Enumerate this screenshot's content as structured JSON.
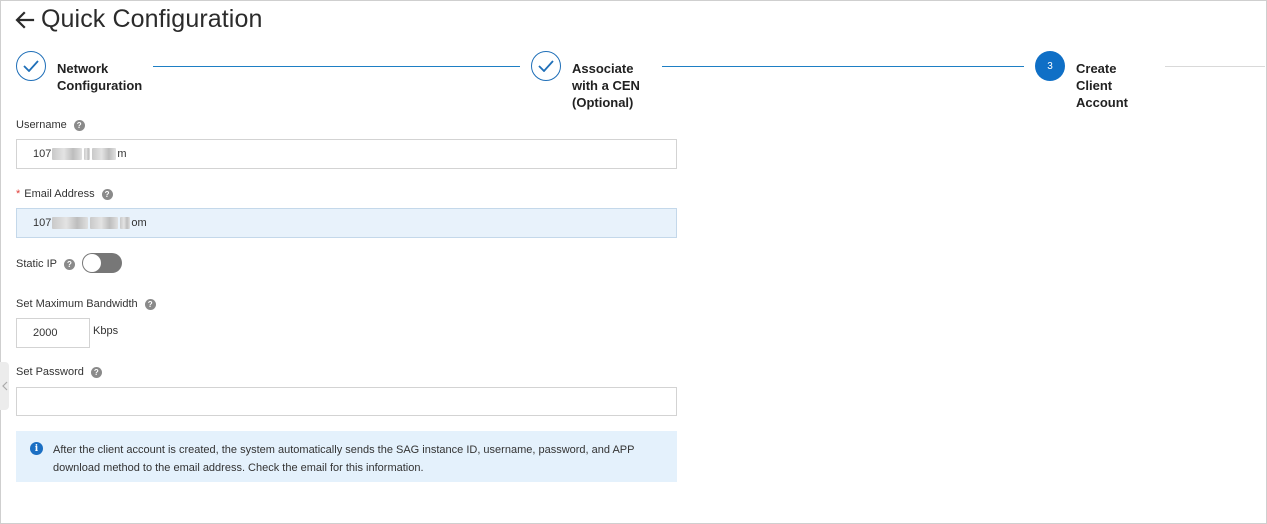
{
  "header": {
    "title": "Quick Configuration",
    "back_icon": "arrow-left-icon"
  },
  "steps": [
    {
      "label": "Network Configuration",
      "state": "done",
      "icon": "check-icon"
    },
    {
      "label": "Associate with a CEN (Optional)",
      "state": "done",
      "icon": "check-icon"
    },
    {
      "label": "Create Client Account",
      "state": "active",
      "number": "3"
    }
  ],
  "form": {
    "username": {
      "label": "Username",
      "value_prefix": "107",
      "value_suffix": "m"
    },
    "email": {
      "label": "Email Address",
      "required_mark": "*",
      "value_prefix": "107",
      "value_suffix": "om"
    },
    "static_ip": {
      "label": "Static IP",
      "enabled": false
    },
    "bandwidth": {
      "label": "Set Maximum Bandwidth",
      "value": "2000",
      "unit": "Kbps"
    },
    "password": {
      "label": "Set Password",
      "value": ""
    }
  },
  "notice": {
    "icon": "info-icon",
    "text": "After the client account is created, the system automatically sends the SAG instance ID, username, password, and APP download method to the email address. Check the email for this information."
  },
  "colors": {
    "accent": "#0f6fc6",
    "step_line": "#1e7fc4",
    "notice_bg": "#e4f1fc",
    "required": "#e0403a"
  }
}
